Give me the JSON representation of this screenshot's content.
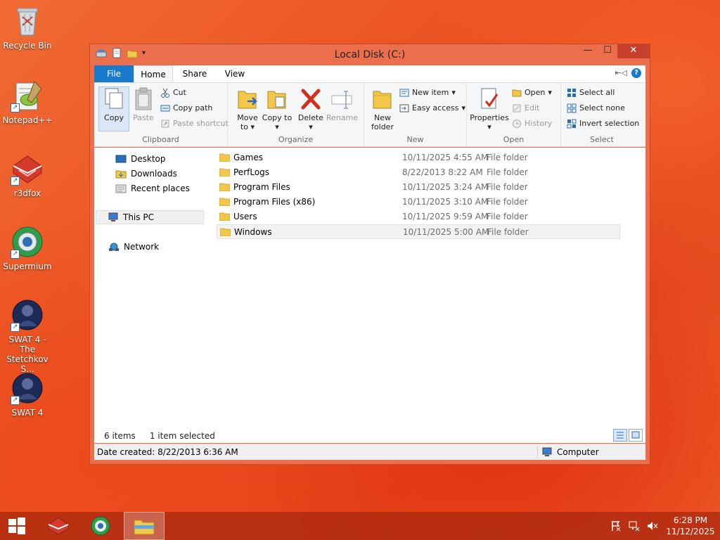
{
  "desktop": {
    "icons": [
      {
        "label": "Recycle Bin",
        "icon": "recycle-bin-icon"
      },
      {
        "label": "Notepad++",
        "icon": "notepadpp-icon"
      },
      {
        "label": "r3dfox",
        "icon": "r3dfox-icon"
      },
      {
        "label": "Supermium",
        "icon": "supermium-icon"
      },
      {
        "label": "SWAT 4 - The Stetchkov S...",
        "icon": "swat4-stetchkov-icon"
      },
      {
        "label": "SWAT 4",
        "icon": "swat4-icon"
      }
    ]
  },
  "window": {
    "title": "Local Disk (C:)",
    "controls": {
      "minimize": "—",
      "maximize": "☐",
      "close": "✕"
    },
    "help": "?",
    "tabs": {
      "file": "File",
      "home": "Home",
      "share": "Share",
      "view": "View"
    },
    "ribbon": {
      "clipboard": {
        "label": "Clipboard",
        "copy": "Copy",
        "paste": "Paste",
        "cut": "Cut",
        "copy_path": "Copy path",
        "paste_shortcut": "Paste shortcut"
      },
      "organize": {
        "label": "Organize",
        "move_to": "Move to",
        "copy_to": "Copy to",
        "delete": "Delete",
        "rename": "Rename"
      },
      "new": {
        "label": "New",
        "new_folder": "New folder",
        "new_item": "New item",
        "easy_access": "Easy access"
      },
      "open": {
        "label": "Open",
        "properties": "Properties",
        "open": "Open",
        "edit": "Edit",
        "history": "History"
      },
      "select": {
        "label": "Select",
        "select_all": "Select all",
        "select_none": "Select none",
        "invert_selection": "Invert selection"
      }
    },
    "nav": {
      "desktop": "Desktop",
      "downloads": "Downloads",
      "recent_places": "Recent places",
      "this_pc": "This PC",
      "network": "Network"
    },
    "files": [
      {
        "name": "Games",
        "date": "10/11/2025 4:55 AM",
        "type": "File folder"
      },
      {
        "name": "PerfLogs",
        "date": "8/22/2013 8:22 AM",
        "type": "File folder"
      },
      {
        "name": "Program Files",
        "date": "10/11/2025 3:24 AM",
        "type": "File folder"
      },
      {
        "name": "Program Files (x86)",
        "date": "10/11/2025 3:10 AM",
        "type": "File folder"
      },
      {
        "name": "Users",
        "date": "10/11/2025 9:59 AM",
        "type": "File folder"
      },
      {
        "name": "Windows",
        "date": "10/11/2025 5:00 AM",
        "type": "File folder"
      }
    ],
    "status": {
      "item_count": "6 items",
      "selected": "1 item selected",
      "date_created": "Date created: 8/22/2013 6:36 AM",
      "location": "Computer"
    }
  },
  "taskbar": {
    "clock_time": "6:28 PM",
    "clock_date": "11/12/2025"
  },
  "colors": {
    "window_frame": "#ec6f4d",
    "file_tab": "#1979ca",
    "close_button": "#c7402b"
  }
}
